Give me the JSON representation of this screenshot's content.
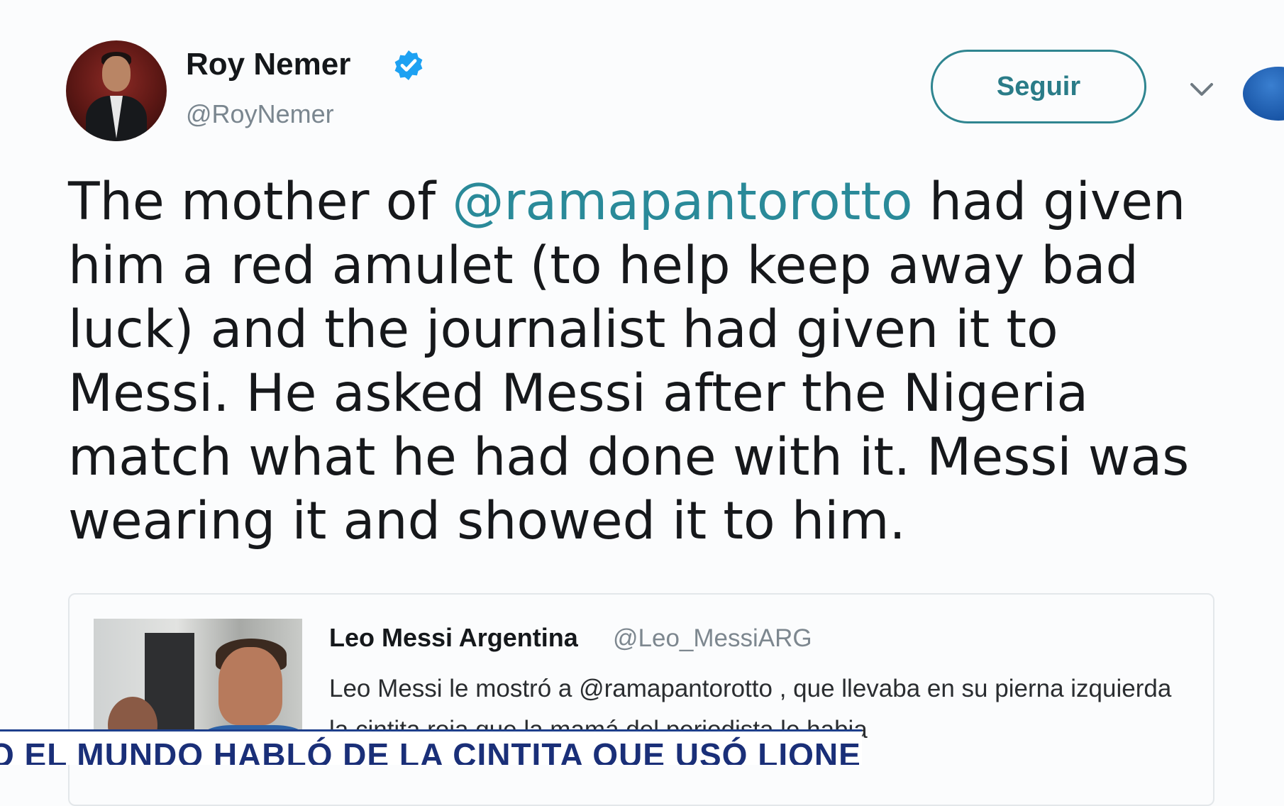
{
  "author": {
    "name": "Roy Nemer",
    "handle": "@RoyNemer",
    "avatar_icon": "profile-photo",
    "verified_icon": "verified-badge-icon"
  },
  "actions": {
    "follow_label": "Seguir",
    "menu_icon": "chevron-down-icon"
  },
  "tweet": {
    "text_before": "The mother of ",
    "mention": "@ramapantorotto",
    "text_after": " had given him a red amulet (to help keep away bad luck) and the journalist had given it to Messi. He asked Messi after the Nigeria match what he had done with it. Messi was wearing it and showed it to him."
  },
  "quoted_tweet": {
    "name": "Leo Messi Argentina",
    "handle": "@Leo_MessiARG",
    "text": "Leo Messi le mostró a @ramapantorotto , que llevaba en su pierna izquierda la cintita roja que la mamá del periodista le habia"
  },
  "lower_third": {
    "text": "O EL MUNDO HABLÓ DE LA CINTITA QUE USÓ LIONEL"
  },
  "colors": {
    "accent": "#2a8a99",
    "follow_border": "#2f8590",
    "verified": "#1da1f2",
    "banner_text": "#1a2f78"
  }
}
